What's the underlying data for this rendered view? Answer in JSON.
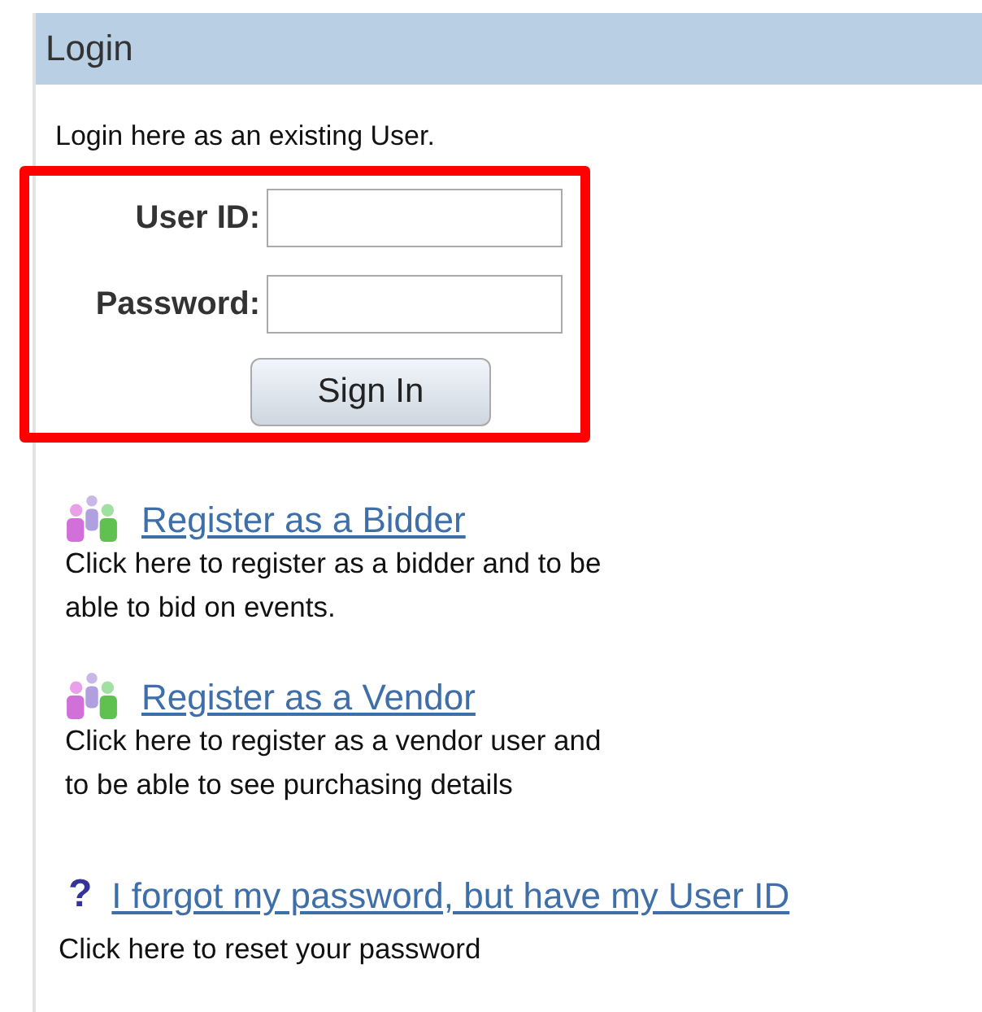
{
  "panel": {
    "title": "Login",
    "intro": "Login here as an existing User."
  },
  "form": {
    "highlighted": true,
    "fields": [
      {
        "label": "User ID:"
      },
      {
        "label": "Password:"
      }
    ],
    "button": "Sign In"
  },
  "links": [
    {
      "kind": "register",
      "label": "Register as a Bidder",
      "description": [
        "Click here to register as a bidder and to be",
        "able to bid on events."
      ]
    },
    {
      "kind": "register",
      "label": "Register as a Vendor",
      "description": [
        "Click here to register as a vendor user and",
        "to be able to see purchasing details"
      ]
    },
    {
      "kind": "help",
      "icon": "?",
      "label": "I forgot my password, but have my User ID",
      "description": [
        "Click here to reset your password"
      ]
    }
  ]
}
